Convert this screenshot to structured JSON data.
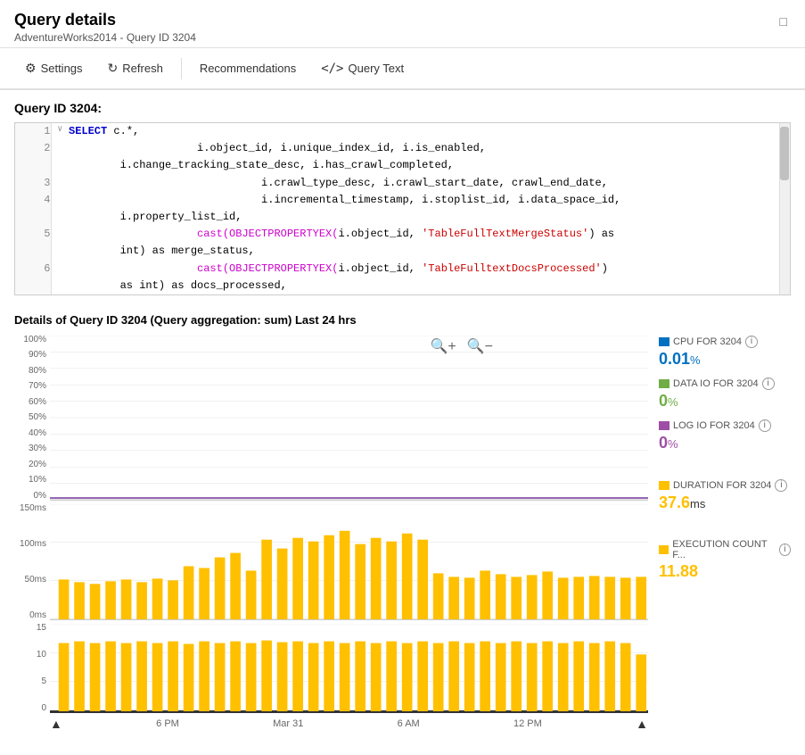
{
  "window": {
    "title": "Query details",
    "subtitle": "AdventureWorks2014 - Query ID 3204",
    "maximize_icon": "□"
  },
  "toolbar": {
    "settings_label": "Settings",
    "refresh_label": "Refresh",
    "recommendations_label": "Recommendations",
    "query_text_label": "Query Text"
  },
  "query_section": {
    "title": "Query ID 3204:"
  },
  "chart_section": {
    "title": "Details of Query ID 3204 (Query aggregation: sum) Last 24 hrs"
  },
  "legend": {
    "cpu_label": "CPU FOR 3204",
    "cpu_value": "0.01",
    "cpu_unit": "%",
    "cpu_color": "#0070c0",
    "data_io_label": "DATA IO FOR 3204",
    "data_io_value": "0",
    "data_io_unit": "%",
    "data_io_color": "#70ad47",
    "log_io_label": "LOG IO FOR 3204",
    "log_io_value": "0",
    "log_io_unit": "%",
    "log_io_color": "#9e4fa5",
    "duration_label": "DURATION FOR 3204",
    "duration_value": "37.6",
    "duration_unit": "ms",
    "duration_color": "#ffc000",
    "exec_label": "EXECUTION COUNT F...",
    "exec_value": "11.88",
    "exec_color": "#ffc000"
  },
  "cpu_chart": {
    "y_labels": [
      "100%",
      "90%",
      "80%",
      "70%",
      "60%",
      "50%",
      "40%",
      "30%",
      "20%",
      "10%",
      "0%"
    ]
  },
  "dur_chart": {
    "y_labels": [
      "150ms",
      "100ms",
      "50ms",
      "0ms"
    ]
  },
  "exec_chart": {
    "y_labels": [
      "15",
      "10",
      "5",
      "0"
    ]
  },
  "x_axis": {
    "labels": [
      "6 PM",
      "Mar 31",
      "6 AM",
      "12 PM"
    ]
  }
}
